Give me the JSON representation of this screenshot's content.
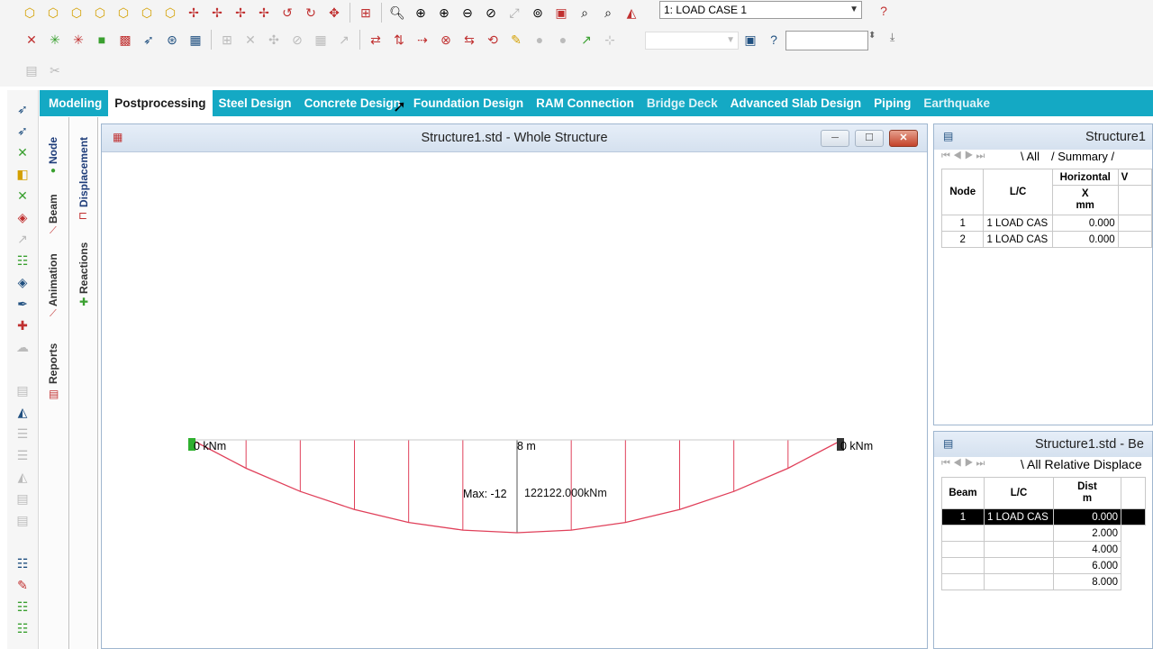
{
  "toolbar": {
    "load_case_select": "1: LOAD CASE 1",
    "input_value": ""
  },
  "tabs": [
    {
      "label": "Modeling"
    },
    {
      "label": "Postprocessing"
    },
    {
      "label": "Steel Design"
    },
    {
      "label": "Concrete Design"
    },
    {
      "label": "Foundation Design"
    },
    {
      "label": "RAM Connection"
    },
    {
      "label": "Bridge Deck"
    },
    {
      "label": "Advanced Slab Design"
    },
    {
      "label": "Piping"
    },
    {
      "label": "Earthquake"
    }
  ],
  "side_tabs": {
    "node": "Node",
    "beam": "Beam",
    "animation": "Animation",
    "reports": "Reports",
    "displacement": "Displacement",
    "reactions": "Reactions"
  },
  "main_window": {
    "title": "Structure1.std - Whole Structure"
  },
  "diagram": {
    "left_label": "0 kNm",
    "right_label": "0 kNm",
    "mid_label": "8 m",
    "max_label": "Max: -12"
  },
  "node_panel": {
    "title": "Structure1",
    "tab_all": "All",
    "tab_summary": "Summary",
    "group_header": "Horizontal",
    "group_header_2": "V",
    "headers": {
      "node": "Node",
      "lc": "L/C",
      "x": "X",
      "unit": "mm"
    },
    "rows": [
      {
        "node": "1",
        "lc": "1 LOAD CAS",
        "x": "0.000"
      },
      {
        "node": "2",
        "lc": "1 LOAD CAS",
        "x": "0.000"
      }
    ]
  },
  "beam_panel": {
    "title": "Structure1.std - Be",
    "tab": "All Relative Displace",
    "headers": {
      "beam": "Beam",
      "lc": "L/C",
      "dist": "Dist",
      "unit": "m"
    },
    "rows": [
      {
        "beam": "1",
        "lc": "1 LOAD CAS",
        "dist": "0.000"
      },
      {
        "beam": "",
        "lc": "",
        "dist": "2.000"
      },
      {
        "beam": "",
        "lc": "",
        "dist": "4.000"
      },
      {
        "beam": "",
        "lc": "",
        "dist": "6.000"
      },
      {
        "beam": "",
        "lc": "",
        "dist": "8.000"
      }
    ]
  },
  "colors": {
    "tabbar": "#14a9c4",
    "diagram_line": "#e0405a"
  }
}
